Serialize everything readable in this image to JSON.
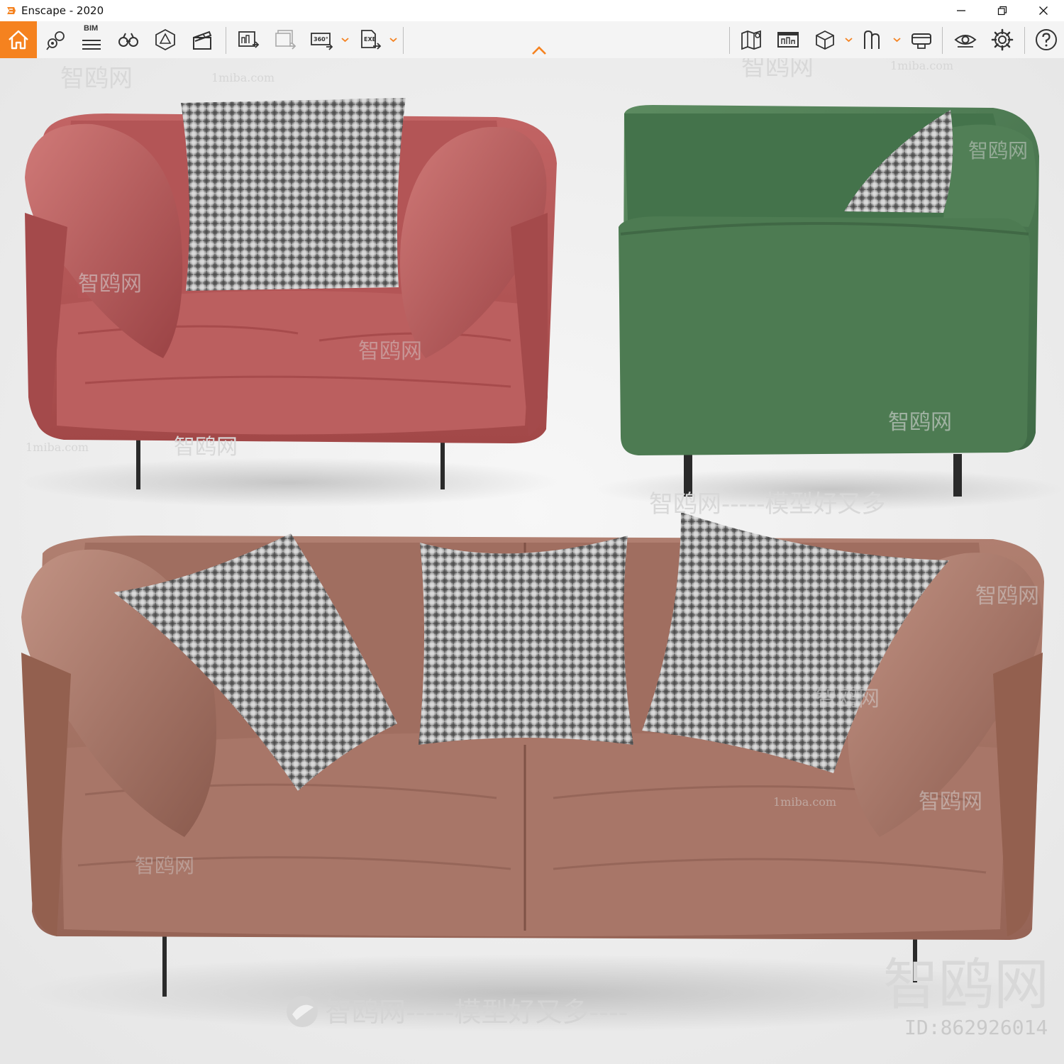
{
  "window": {
    "title": "Enscape - 2020",
    "brand_color": "#f5821f"
  },
  "toolbar": {
    "left_tools": [
      {
        "name": "home",
        "icon": "home-icon"
      },
      {
        "name": "views",
        "icon": "map-pin-icon"
      },
      {
        "name": "bim",
        "icon": "bim-list-icon",
        "label": "BIM"
      },
      {
        "name": "walk",
        "icon": "binoculars-icon"
      },
      {
        "name": "asset-library",
        "icon": "asset-library-icon"
      },
      {
        "name": "video-editor",
        "icon": "clapperboard-icon"
      },
      {
        "name": "screenshot",
        "icon": "render-image-icon"
      },
      {
        "name": "batch-render",
        "icon": "batch-render-icon"
      },
      {
        "name": "panorama",
        "icon": "panorama-icon",
        "label": "360°"
      },
      {
        "name": "export",
        "icon": "export-exe-icon",
        "label": "EXE"
      }
    ],
    "right_tools": [
      {
        "name": "map",
        "icon": "map-icon"
      },
      {
        "name": "info-panel",
        "icon": "info-panel-icon"
      },
      {
        "name": "view-mode",
        "icon": "cube-icon"
      },
      {
        "name": "presets",
        "icon": "presets-icon"
      },
      {
        "name": "vr-headset",
        "icon": "vr-headset-icon"
      },
      {
        "name": "visual-settings",
        "icon": "eye-icon"
      },
      {
        "name": "general-settings",
        "icon": "gear-icon"
      },
      {
        "name": "help",
        "icon": "help-icon"
      }
    ]
  },
  "viewport": {
    "watermarks": {
      "brand": "智鸥网",
      "site": "1miba.com",
      "slogan": "智鸥网-----模型好又多----",
      "slogan_mid": "智鸥网-----模型好又多",
      "id_text": "ID:862926014"
    },
    "colors": {
      "red_leather": "#b4595a",
      "green_velvet": "#4c7a52",
      "brown_leather": "#a57466",
      "pillow": "#9a9a9a"
    }
  }
}
